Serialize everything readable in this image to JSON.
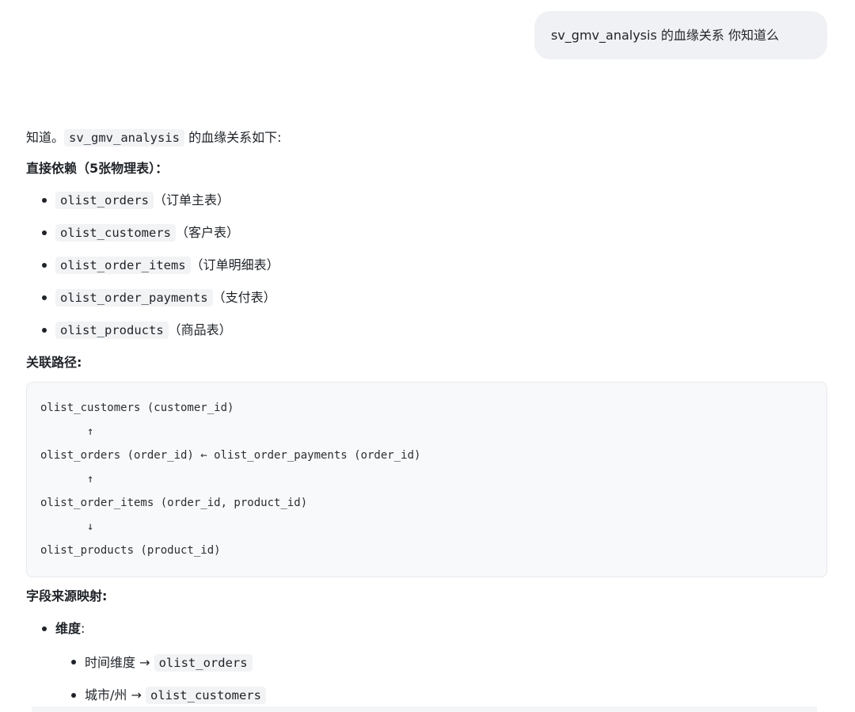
{
  "user_message": "sv_gmv_analysis 的血缘关系 你知道么",
  "intro": {
    "before": "知道。",
    "code": "sv_gmv_analysis",
    "after": " 的血缘关系如下:"
  },
  "direct_deps_heading": "直接依赖（5张物理表）：",
  "direct_deps": [
    {
      "code": "olist_orders",
      "desc": "（订单主表）"
    },
    {
      "code": "olist_customers",
      "desc": "（客户表）"
    },
    {
      "code": "olist_order_items",
      "desc": "（订单明细表）"
    },
    {
      "code": "olist_order_payments",
      "desc": "（支付表）"
    },
    {
      "code": "olist_products",
      "desc": "（商品表）"
    }
  ],
  "join_path_heading": "关联路径:",
  "code_lines": [
    "olist_customers (customer_id)",
    "       ↑",
    "olist_orders (order_id) ← olist_order_payments (order_id)",
    "       ↑",
    "olist_order_items (order_id, product_id)",
    "       ↓",
    "olist_products (product_id)"
  ],
  "field_mapping_heading": "字段来源映射:",
  "dimension_label": "维度",
  "dimension_colon": ":",
  "dimension_items": [
    {
      "label": "时间维度 → ",
      "code": "olist_orders"
    },
    {
      "label": "城市/州 → ",
      "code": "olist_customers"
    }
  ]
}
